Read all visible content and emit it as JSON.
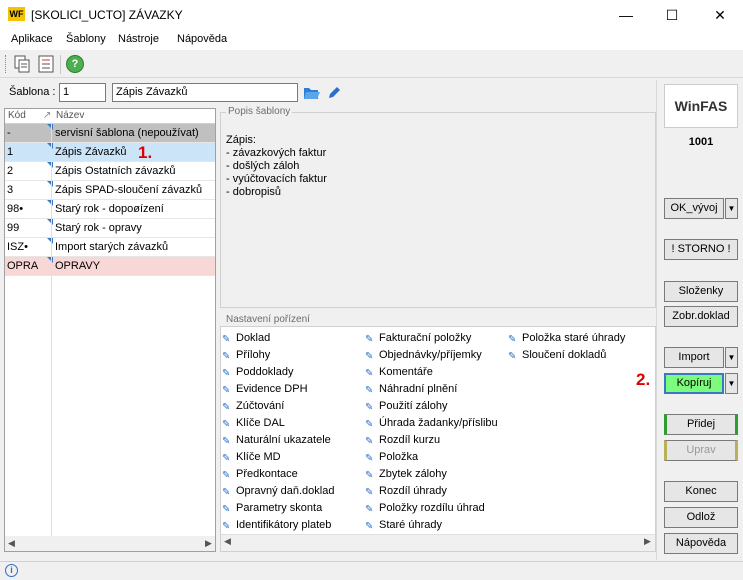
{
  "window": {
    "title": "[SKOLICI_UCTO] ZÁVAZKY",
    "app_logo": "WF",
    "minimize": "—",
    "maximize": "☐",
    "close": "✕"
  },
  "menu": [
    "Aplikace",
    "Šablony",
    "Nástroje",
    "Nápověda"
  ],
  "toolbar": {
    "icons": [
      "copy-template-icon",
      "list-icon",
      "help-icon"
    ],
    "help_glyph": "?"
  },
  "sablona": {
    "label": "Šablona :",
    "number": "1",
    "name": "Zápis Závazků"
  },
  "grid": {
    "headers": [
      "Kód",
      "Název"
    ],
    "rows": [
      {
        "kod": "-",
        "nazev": "servisní šablona (nepoužívat)"
      },
      {
        "kod": "1",
        "nazev": "Zápis Závazků"
      },
      {
        "kod": "2",
        "nazev": "Zápis Ostatních závazků"
      },
      {
        "kod": "3",
        "nazev": "Zápis SPAD-sloučení závazků"
      },
      {
        "kod": "98•",
        "nazev": "Starý rok - dopoøízení"
      },
      {
        "kod": "99",
        "nazev": "Starý rok - opravy"
      },
      {
        "kod": "ISZ•",
        "nazev": "Import starých závazků"
      },
      {
        "kod": "OPRA",
        "nazev": "OPRAVY"
      }
    ]
  },
  "popis": {
    "label": "Popis šablony",
    "lines": [
      "Zápis:",
      "- závazkových faktur",
      "- došlých záloh",
      "- vyúčtovacích faktur",
      "- dobropisů"
    ]
  },
  "nastaveni": {
    "label": "Nastavení pořízení",
    "col1": [
      "Doklad",
      "Přílohy",
      "Poddoklady",
      "Evidence DPH",
      "Zúčtování",
      "Klíče DAL",
      "Naturální ukazatele",
      "Klíče MD",
      "Předkontace",
      "Opravný daň.doklad",
      "Parametry skonta",
      "Identifikátory plateb"
    ],
    "col2": [
      "Fakturační položky",
      "Objednávky/příjemky",
      "Komentáře",
      "Náhradní plnění",
      "Použití zálohy",
      "Úhrada žadanky/příslibu",
      "Rozdíl kurzu",
      "Položka",
      "Zbytek zálohy",
      "Rozdíl úhrady",
      "Položky rozdílu úhrad",
      "Staré úhrady"
    ],
    "col3": [
      "Položka staré úhrady",
      "Sloučení dokladů"
    ]
  },
  "right": {
    "logo": "WinFAS",
    "code": "1001",
    "ok_vyvoj": "OK_vývoj",
    "storno": "! STORNO !",
    "slozenky": "Složenky",
    "zobr_doklad": "Zobr.doklad",
    "import": "Import",
    "kopiruj": "Kopíruj",
    "pridej": "Přidej",
    "uprav": "Uprav",
    "konec": "Konec",
    "odloz": "Odlož",
    "napoveda": "Nápověda"
  },
  "annotations": {
    "a1": "1.",
    "a2": "2."
  },
  "colors": {
    "selected_row": "#cce4f7",
    "service_row": "#c0c0c0",
    "opravy_row": "#f8d7d7",
    "kopiruj": "#7cfc7c",
    "annotation": "#e00000"
  }
}
